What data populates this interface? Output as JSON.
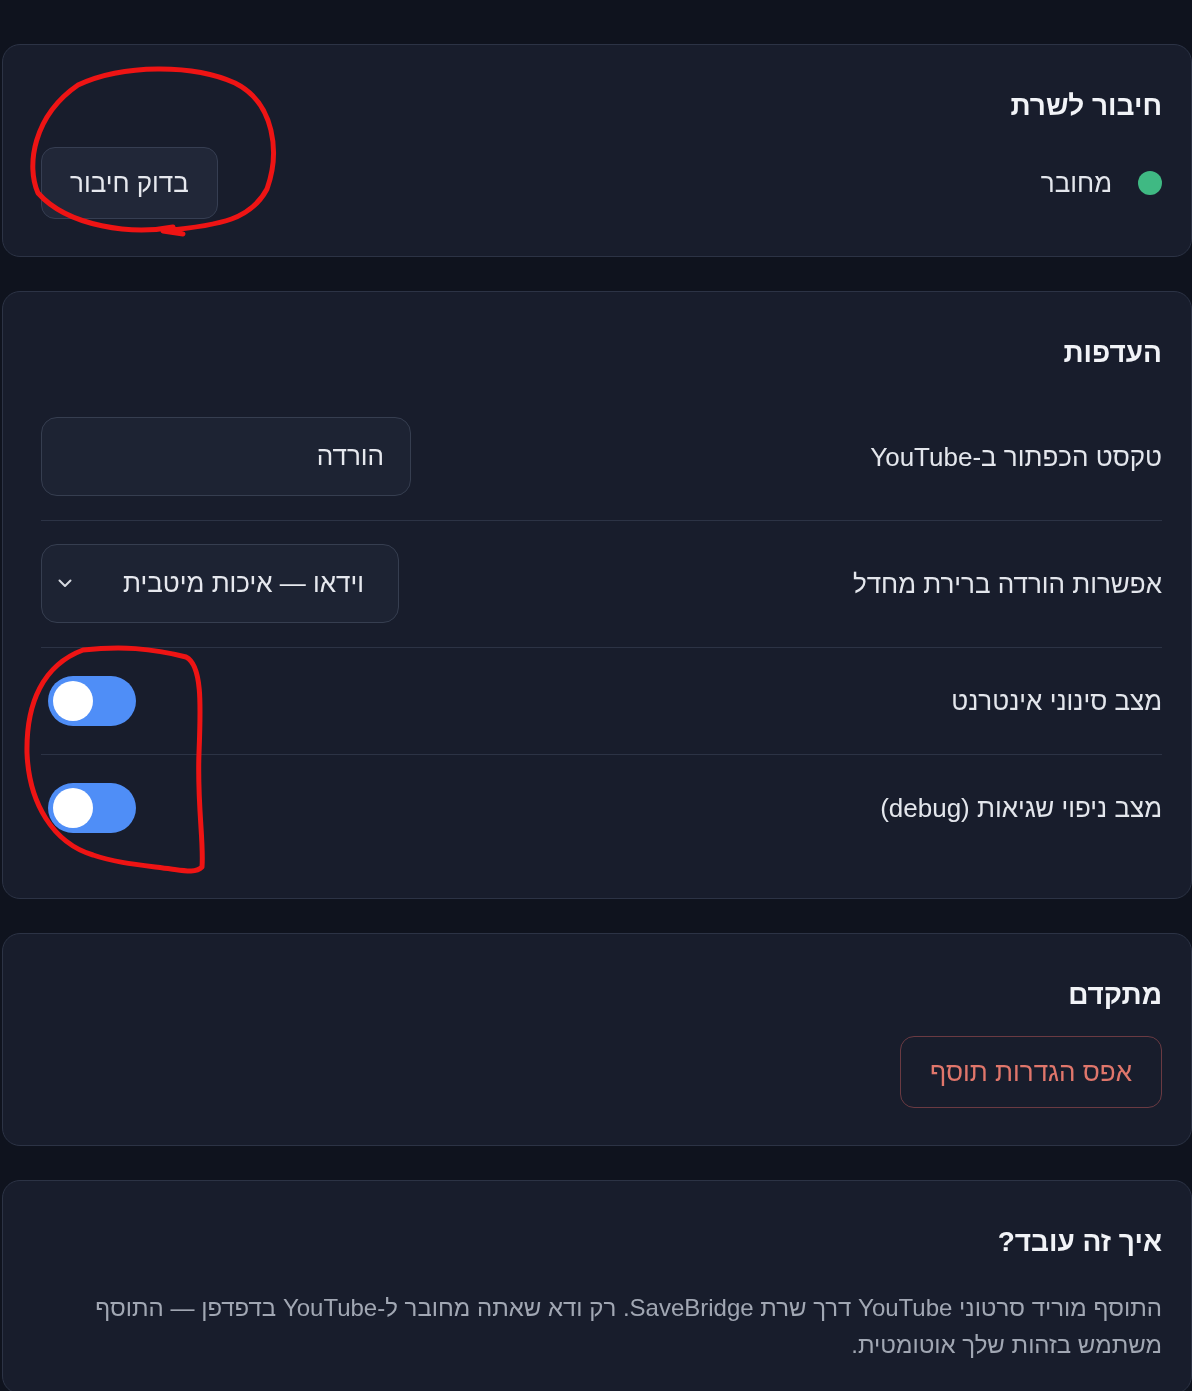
{
  "server": {
    "title": "חיבור לשרת",
    "status": {
      "label": "מחובר",
      "connected": true
    },
    "check_button": {
      "label": "בדוק חיבור",
      "circled": true
    }
  },
  "preferences": {
    "title": "העדפות",
    "fields": [
      {
        "kind": "text",
        "label": "טקסט הכפתור ב-YouTube",
        "value": "הורדה"
      },
      {
        "kind": "select",
        "label": "אפשרות הורדה ברירת מחדל",
        "value": "וידאו — איכות מיטבית"
      }
    ],
    "toggles": [
      {
        "label": "מצב סינוני אינטרנט",
        "on": true
      },
      {
        "label": "מצב ניפוי שגיאות (debug)",
        "on": true
      }
    ],
    "toggles_circled": true
  },
  "advanced": {
    "title": "מתקדם",
    "reset_button": {
      "label": "אפס הגדרות תוסף"
    }
  },
  "about": {
    "title": "איך זה עובד?",
    "text": "התוסף מוריד סרטוני YouTube דרך שרת SaveBridge. רק ודא שאתה מחובר ל-YouTube בדפדפן — התוסף משתמש בזהות שלך אוטומטית."
  }
}
